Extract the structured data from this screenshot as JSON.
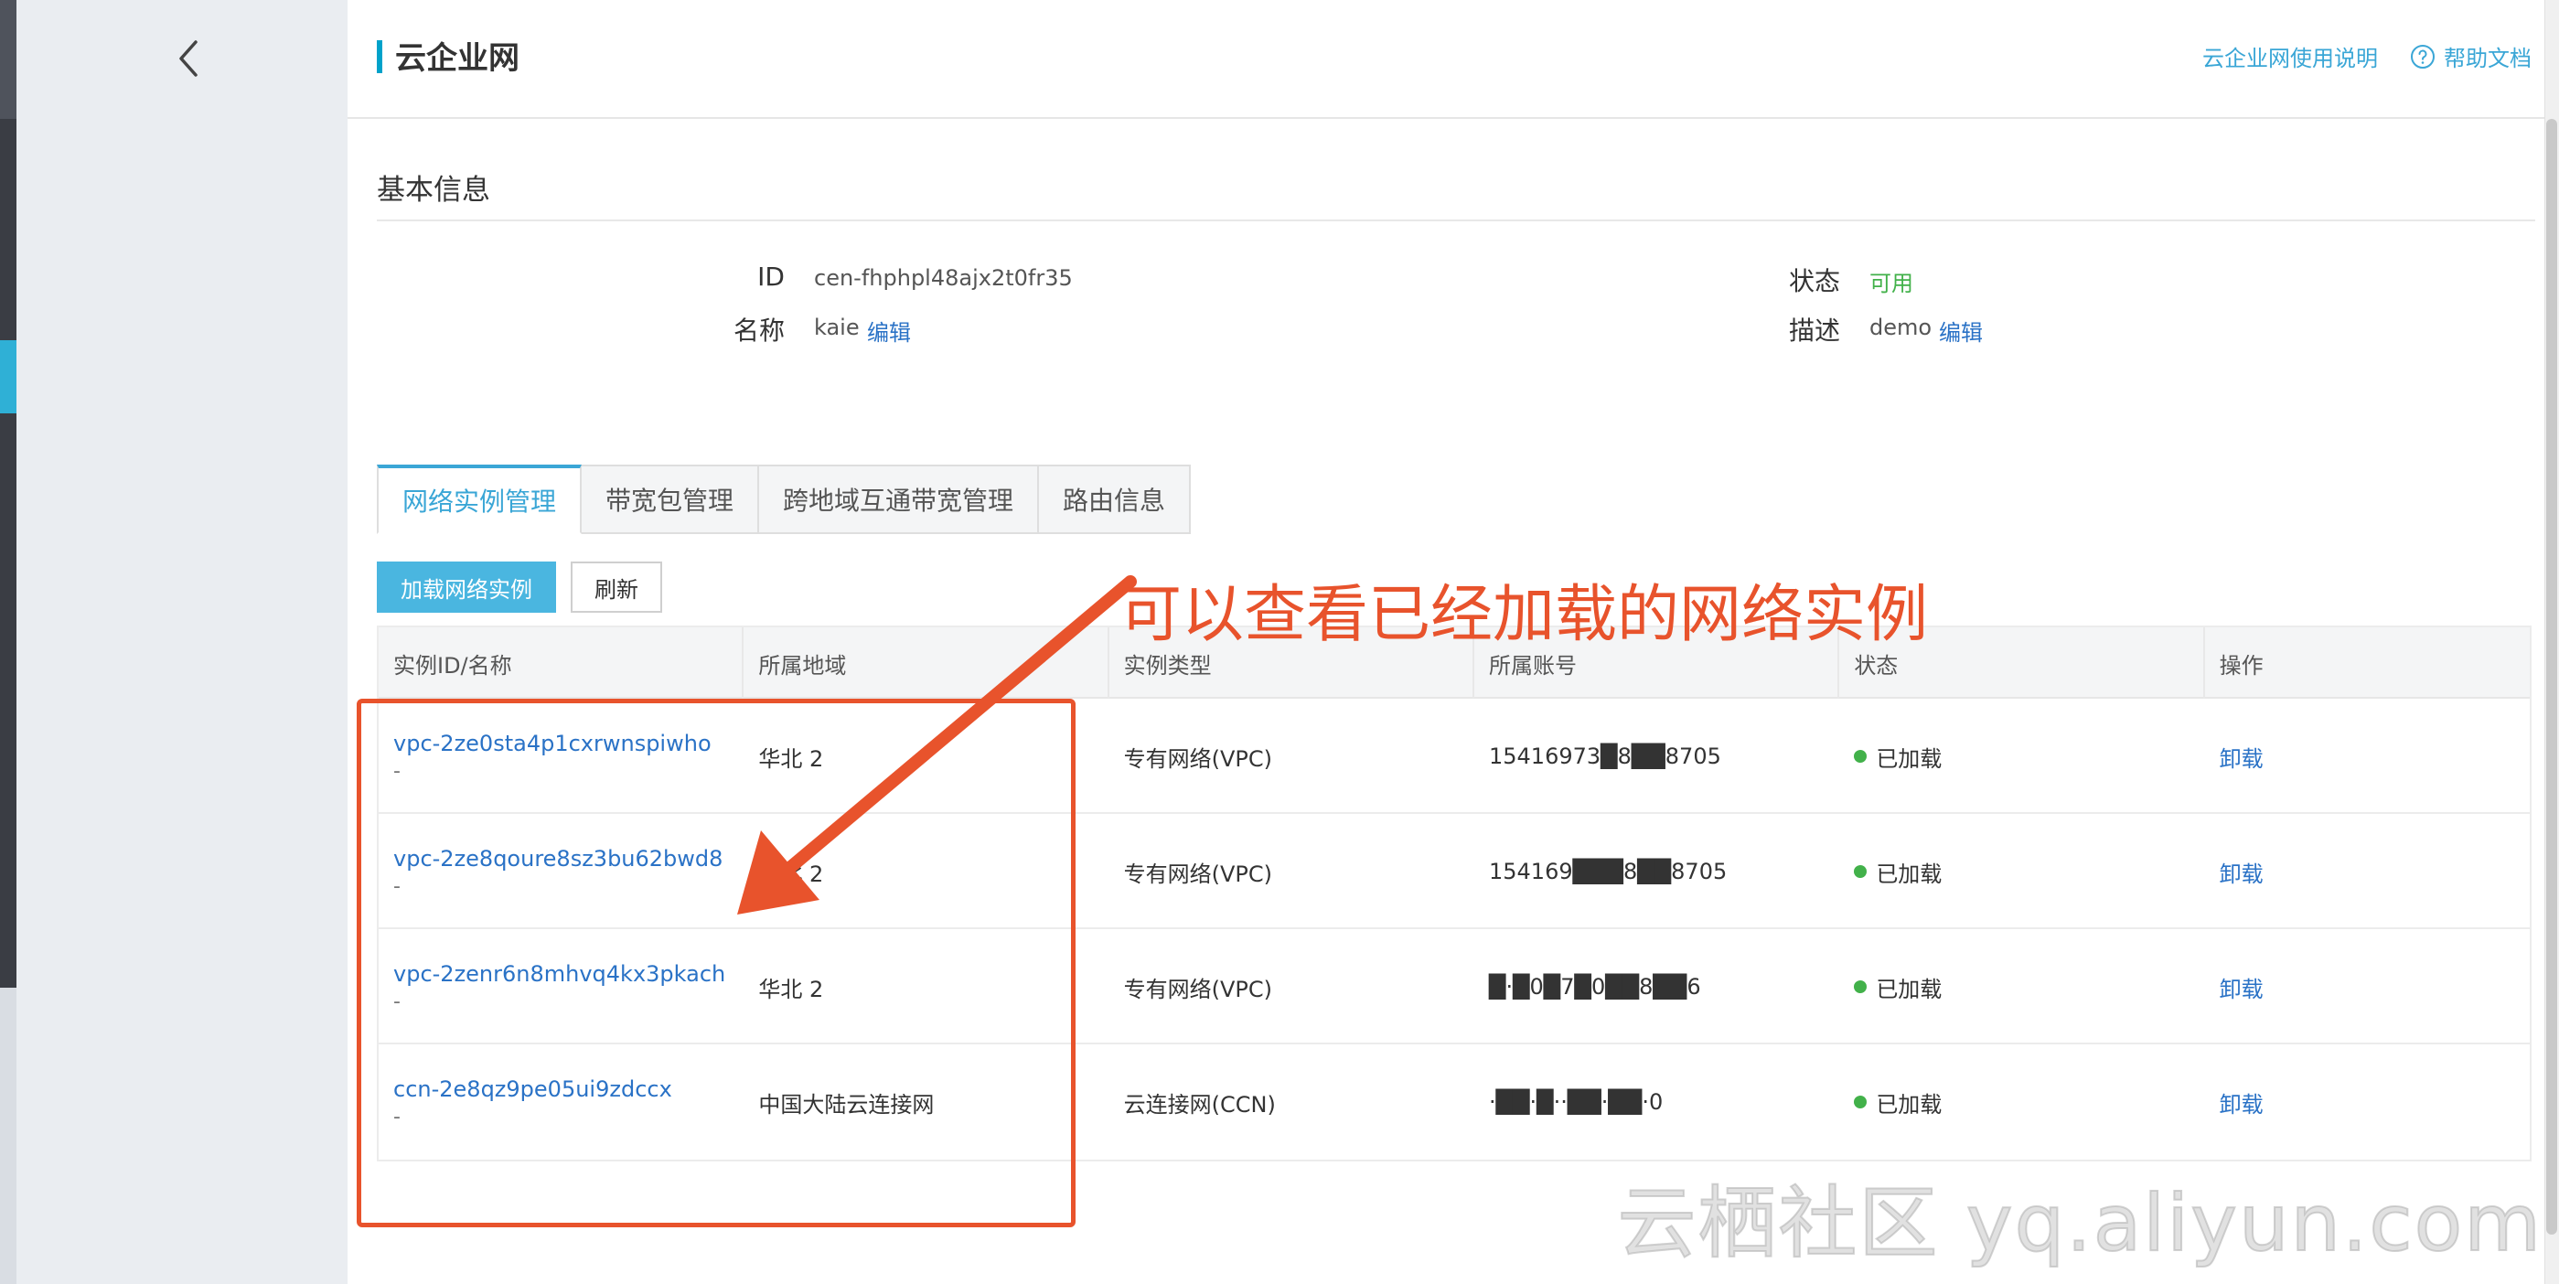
{
  "header": {
    "title": "云企业网",
    "usage_link": "云企业网使用说明",
    "help_link": "帮助文档"
  },
  "basic_info": {
    "section_title": "基本信息",
    "id_label": "ID",
    "id_value": "cen-fhphpl48ajx2t0fr35",
    "name_label": "名称",
    "name_value": "kaie",
    "name_edit": "编辑",
    "status_label": "状态",
    "status_value": "可用",
    "desc_label": "描述",
    "desc_value": "demo",
    "desc_edit": "编辑"
  },
  "tabs": [
    {
      "label": "网络实例管理",
      "active": true
    },
    {
      "label": "带宽包管理",
      "active": false
    },
    {
      "label": "跨地域互通带宽管理",
      "active": false
    },
    {
      "label": "路由信息",
      "active": false
    }
  ],
  "buttons": {
    "load_instance": "加载网络实例",
    "refresh": "刷新"
  },
  "table": {
    "headers": [
      "实例ID/名称",
      "所属地域",
      "实例类型",
      "所属账号",
      "状态",
      "操作"
    ],
    "rows": [
      {
        "id": "vpc-2ze0sta4p1cxrwnspiwho",
        "name": "-",
        "region": "华北 2",
        "type": "专有网络(VPC)",
        "account": "15416973█8██8705",
        "status": "已加载",
        "action": "卸载"
      },
      {
        "id": "vpc-2ze8qoure8sz3bu62bwd8",
        "name": "-",
        "region": "华北 2",
        "type": "专有网络(VPC)",
        "account": "154169███8██8705",
        "status": "已加载",
        "action": "卸载"
      },
      {
        "id": "vpc-2zenr6n8mhvq4kx3pkach",
        "name": "-",
        "region": "华北 2",
        "type": "专有网络(VPC)",
        "account": "█·█0█7█0██8██6",
        "status": "已加载",
        "action": "卸载"
      },
      {
        "id": "ccn-2e8qz9pe05ui9zdccx",
        "name": "-",
        "region": "中国大陆云连接网",
        "type": "云连接网(CCN)",
        "account": "·██·█··██·██·0",
        "status": "已加载",
        "action": "卸载"
      }
    ]
  },
  "annotation": {
    "text": "可以查看已经加载的网络实例",
    "color": "#e8532c"
  },
  "watermark": "云栖社区 yq.aliyun.com",
  "colors": {
    "accent": "#3aa6d6",
    "link": "#2a72c6",
    "success": "#42b14a",
    "annotation": "#e8532c"
  }
}
